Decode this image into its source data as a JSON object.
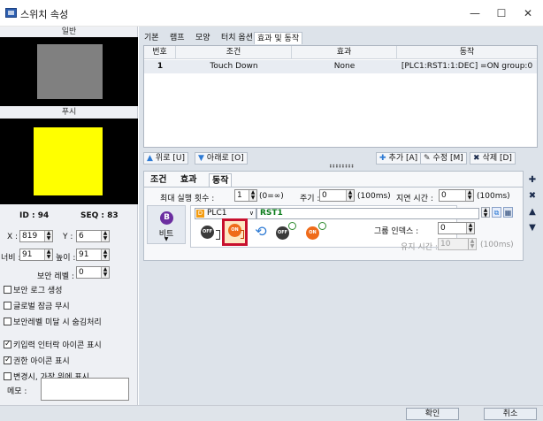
{
  "window": {
    "title": "스위치 속성",
    "min_glyph": "—",
    "max_glyph": "☐",
    "close_glyph": "✕"
  },
  "left": {
    "normal_header": "일반",
    "push_header": "푸시",
    "id_label": "ID : ",
    "id_value": "94",
    "seq_label": "SEQ : ",
    "seq_value": "83",
    "x_label": "X :",
    "x_value": "819",
    "y_label": "Y :",
    "y_value": "6",
    "width_label": "너비 :",
    "width_value": "91",
    "height_label": "높이 :",
    "height_value": "91",
    "security_label": "보안 레벨 :",
    "security_value": "0",
    "checks1": [
      {
        "label": "보안 로그 생성",
        "checked": false
      },
      {
        "label": "글로벌 잠금 무시",
        "checked": false
      },
      {
        "label": "보안레벨 미달 시 숨김처리",
        "checked": false
      }
    ],
    "checks2": [
      {
        "label": "키입력 인터락 아이콘 표시",
        "checked": true
      },
      {
        "label": "권한 아이콘 표시",
        "checked": true
      },
      {
        "label": "변경시, 가장 위에 표시",
        "checked": false
      }
    ],
    "memo_label": "메모 :"
  },
  "tabs": [
    "기본",
    "램프",
    "모양",
    "터치 옵션",
    "효과 및 동작"
  ],
  "grid": {
    "headers": [
      "번호",
      "조건",
      "효과",
      "동작"
    ],
    "rows": [
      [
        "1",
        "Touch Down",
        "None",
        "[PLC1:RST1:1:DEC] =ON group:0"
      ]
    ]
  },
  "toolbar": {
    "up": "위로 [U]",
    "down": "아래로 [O]",
    "add": "추가 [A]",
    "edit": "수정 [M]",
    "delete": "삭제 [D]"
  },
  "detail": {
    "subtabs": [
      "조건",
      "효과",
      "동작"
    ],
    "max_exec_label": "최대 실행 횟수 :",
    "max_exec_value": "1",
    "max_exec_unit": "(0=∞)",
    "period_label": "주기 :",
    "period_value": "0",
    "period_unit": "(100ms)",
    "delay_label": "지연 시간 :",
    "delay_value": "0",
    "delay_unit": "(100ms)",
    "bit_label": "비트",
    "plc_value": "PLC1",
    "address_value": "RST1",
    "group_index_label": "그룹 인덱스 :",
    "group_index_value": "0",
    "hold_label": "유지 시간 :",
    "hold_value": "10",
    "hold_unit": "(100ms)",
    "off_text": "OFF",
    "on_text": "ON"
  },
  "buttons": {
    "ok": "확인",
    "cancel": "취소"
  },
  "colors": {
    "accent_blue": "#2f7bd4",
    "highlight_red": "#c8102e",
    "push_yellow": "#ffff00",
    "push_gray": "#808080"
  }
}
